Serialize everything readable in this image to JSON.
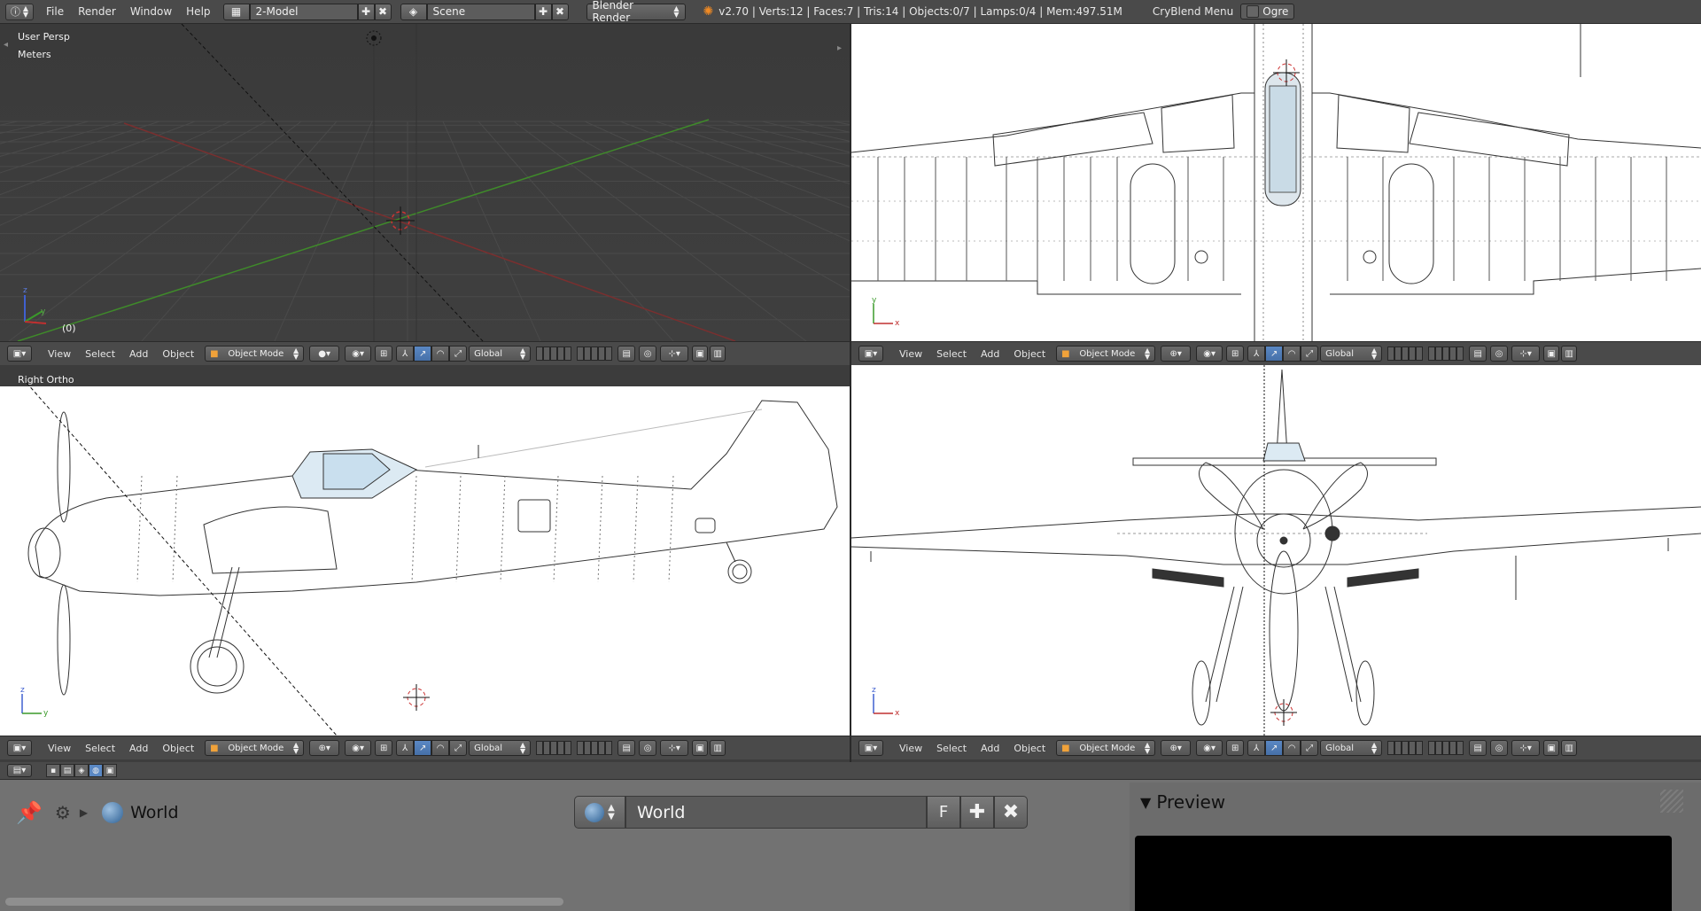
{
  "topbar": {
    "menus": [
      "File",
      "Render",
      "Window",
      "Help"
    ],
    "layout_name": "2-Model",
    "scene_name": "Scene",
    "render_engine": "Blender Render",
    "stats": "v2.70 | Verts:12 | Faces:7 | Tris:14 | Objects:0/7 | Lamps:0/4 | Mem:497.51M",
    "addon_menu": "CryBlend Menu",
    "ogre_label": "Ogre"
  },
  "viewports": {
    "persp": {
      "label": "User Persp",
      "units": "Meters",
      "frame": "(0)"
    },
    "ortho_right": {
      "label": "Right Ortho"
    }
  },
  "viewport_header": {
    "view": "View",
    "select": "Select",
    "add": "Add",
    "object": "Object",
    "mode": "Object Mode",
    "orientation": "Global"
  },
  "properties": {
    "breadcrumb": "World",
    "world_name": "World",
    "fake_user": "F",
    "preview_title": "Preview"
  },
  "colors": {
    "bg": "#3d3d3d",
    "header": "#4a4a4a",
    "grid_bg": "#3c3c3c",
    "x_axis": "#8a2b2b",
    "y_axis": "#4b8a2b",
    "blueprint_bg": "#ffffff",
    "accent": "#5a88c4"
  }
}
